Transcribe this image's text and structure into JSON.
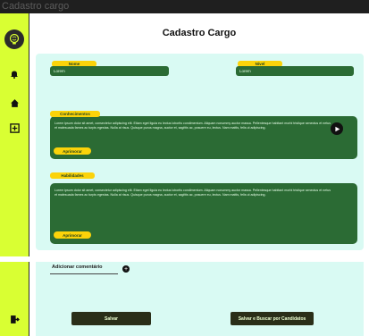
{
  "window": {
    "title": "Cadastro cargo"
  },
  "sidebar": {
    "icons": [
      "brain-lightbulb-logo-icon",
      "bell-icon",
      "home-icon",
      "add-square-icon",
      "logout-icon"
    ]
  },
  "page": {
    "title": "Cadastro Cargo"
  },
  "form": {
    "nome": {
      "label": "Nome",
      "value": "Lorem"
    },
    "nivel": {
      "label": "Nível",
      "value": "Lorem"
    },
    "conhecimentos": {
      "label": "Conhecimentos",
      "text": "Lorem ipsum dolor sit amet, consectetur adipiscing elit. Etiam eget ligula eu lectus lobortis condimentum. Aliquam nonummy auctor massa. Pellentesque habitant morbi tristique senectus et netus et malesuada fames ac turpis egestas. Nulla at risus. Quisque purus magna, auctor et, sagittis ac, posuere eu, lectus. Nam mattis, felis ut adipiscing.",
      "button": "Aprimorar"
    },
    "habilidades": {
      "label": "Habilidades",
      "text": "Lorem ipsum dolor sit amet, consectetur adipiscing elit. Etiam eget ligula eu lectus lobortis condimentum. Aliquam nonummy auctor massa. Pellentesque habitant morbi tristique senectus et netus et malesuada fames ac turpis egestas. Nulla at risus. Quisque purus magna, auctor et, sagittis ac, posuere eu, lectus. Nam mattis, felis ut adipiscing.",
      "button": "Aprimorar"
    },
    "comment": {
      "label": "Adicionar comentário"
    },
    "actions": {
      "save": "Salvar",
      "save_search": "Salvar e Buscar por Candidatos"
    }
  },
  "colors": {
    "sidebar": "#d9ff33",
    "panel": "#d9faf3",
    "field": "#2b6b34",
    "accent": "#fbd30a",
    "button": "#2a2e18"
  }
}
